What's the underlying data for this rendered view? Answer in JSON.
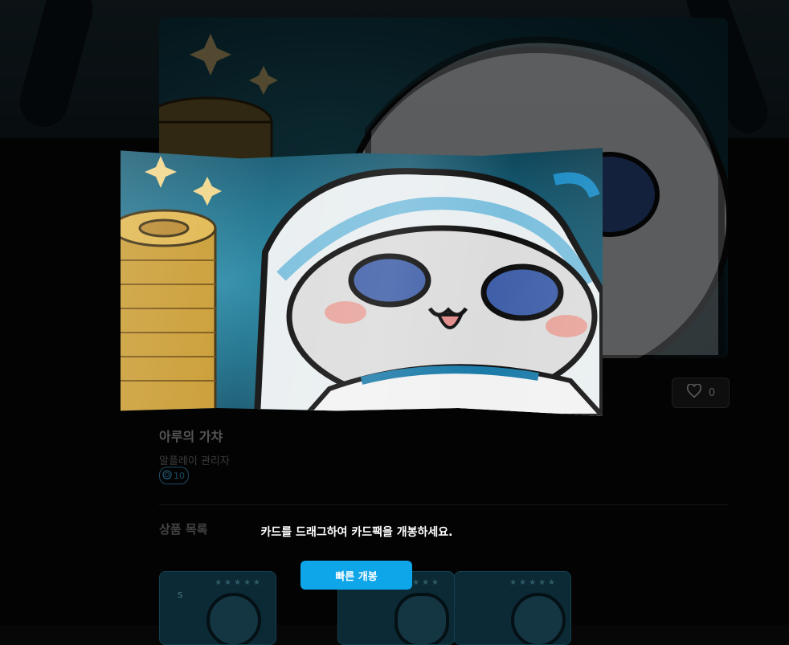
{
  "page": {
    "title": "아루의 가챠",
    "creator": "알플레이 관리자",
    "price": "10",
    "like_count": "0",
    "section_title": "상품 목록"
  },
  "overlay": {
    "instruction": "카드를 드래그하여 카드팩을 개봉하세요.",
    "quick_open_label": "빠른 개봉"
  },
  "cards": [
    {
      "rank": "S",
      "stars": "★★★★★"
    },
    {
      "rank": "",
      "stars": "★★★★★"
    },
    {
      "rank": "",
      "stars": "★★★★★"
    }
  ],
  "colors": {
    "accent": "#0ea5e9",
    "background": "#070707",
    "pack_blue": "#1b6f8a"
  },
  "icons": {
    "like": "heart-icon",
    "price": "coin-icon"
  }
}
